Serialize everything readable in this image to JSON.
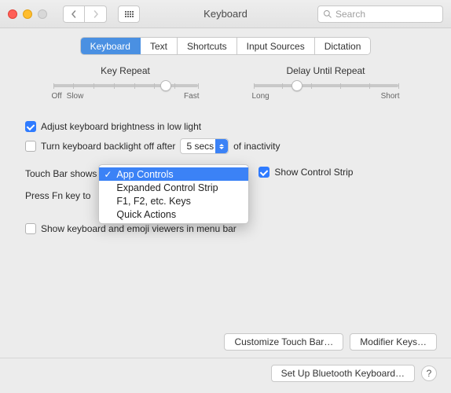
{
  "window": {
    "title": "Keyboard"
  },
  "search": {
    "placeholder": "Search"
  },
  "tabs": [
    "Keyboard",
    "Text",
    "Shortcuts",
    "Input Sources",
    "Dictation"
  ],
  "active_tab": "Keyboard",
  "sliders": {
    "key_repeat": {
      "label": "Key Repeat",
      "left": "Off",
      "left2": "Slow",
      "right": "Fast",
      "value_pct": 78
    },
    "delay": {
      "label": "Delay Until Repeat",
      "left": "Long",
      "right": "Short",
      "value_pct": 30
    }
  },
  "checks": {
    "brightness": {
      "label": "Adjust keyboard brightness in low light",
      "checked": true
    },
    "backlight_off": {
      "label": "Turn keyboard backlight off after",
      "checked": false
    },
    "backlight_after_value": "5 secs",
    "backlight_suffix": "of inactivity",
    "show_control_strip": {
      "label": "Show Control Strip",
      "checked": true
    },
    "show_viewers": {
      "label": "Show keyboard and emoji viewers in menu bar",
      "checked": false
    }
  },
  "touchbar": {
    "label": "Touch Bar shows",
    "options": [
      "App Controls",
      "Expanded Control Strip",
      "F1, F2, etc. Keys",
      "Quick Actions"
    ],
    "selected": "App Controls"
  },
  "fnkey": {
    "label": "Press Fn key to"
  },
  "buttons": {
    "customize": "Customize Touch Bar…",
    "modifier": "Modifier Keys…",
    "bluetooth": "Set Up Bluetooth Keyboard…",
    "help": "?"
  }
}
